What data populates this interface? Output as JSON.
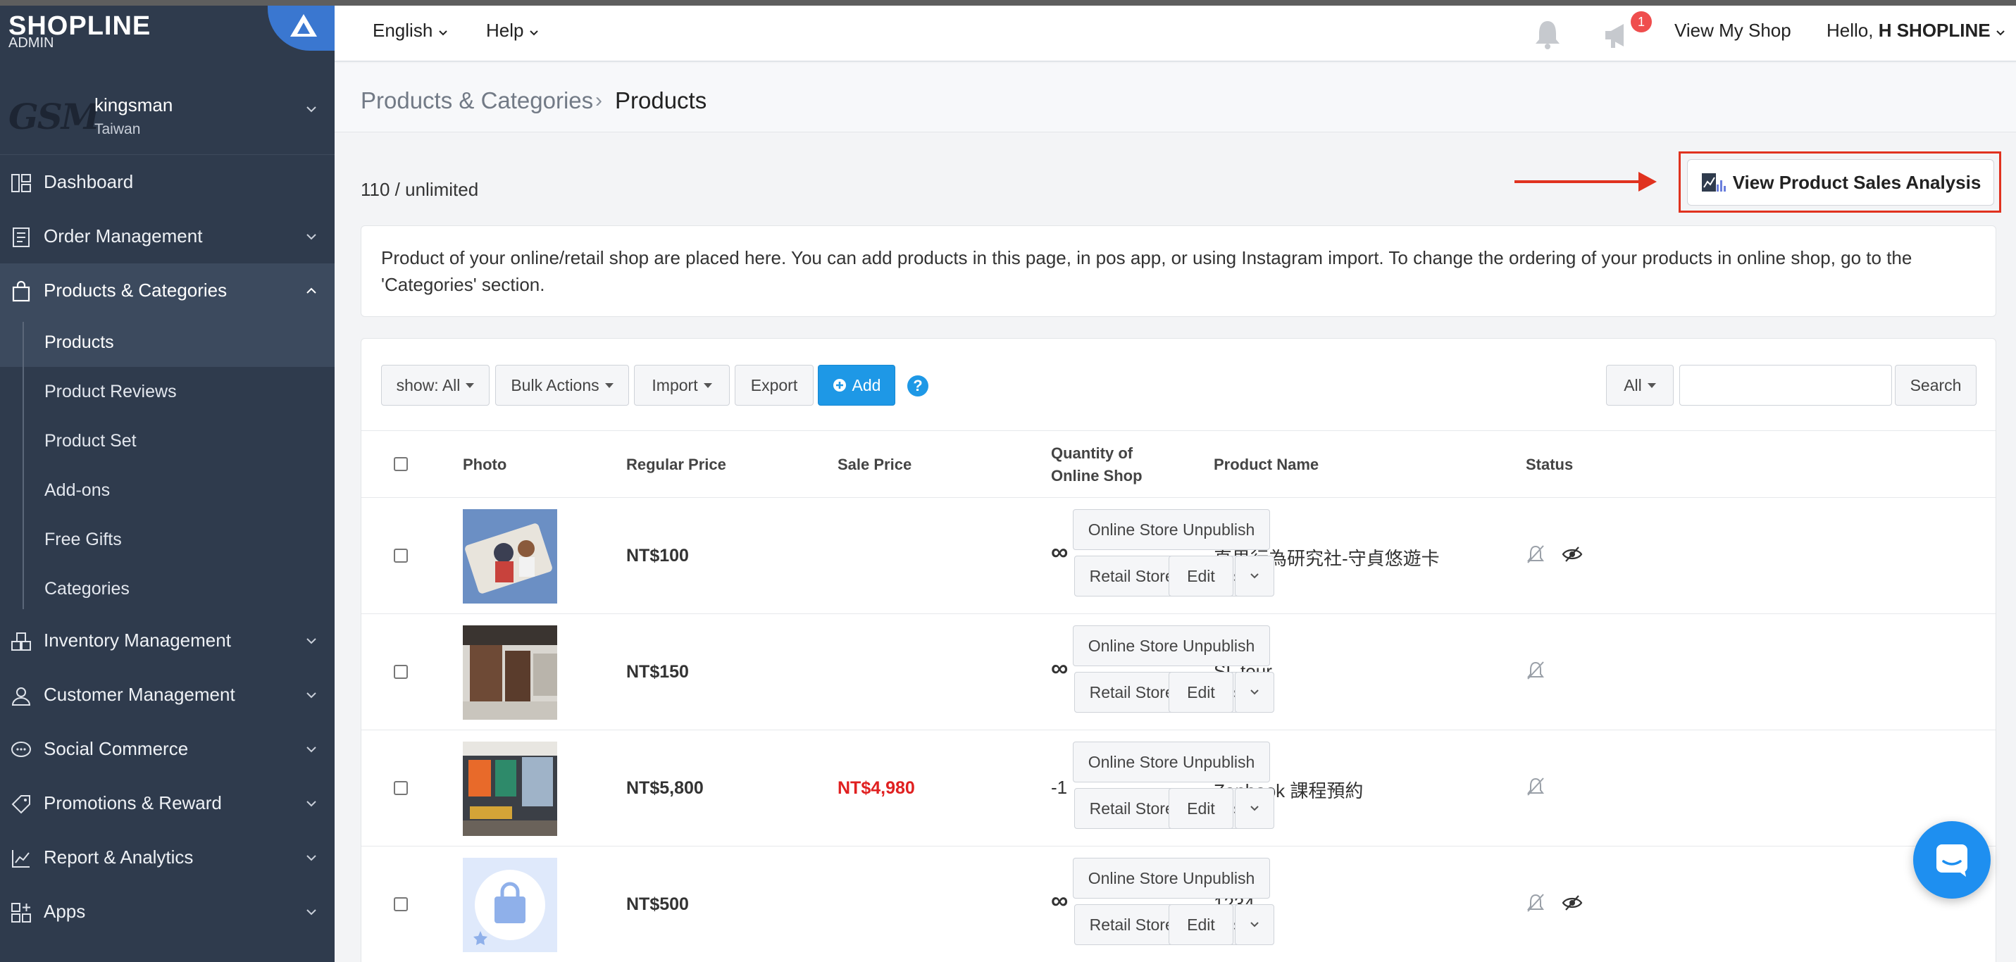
{
  "brand": {
    "logo_text": "SHOPLINE",
    "logo_sub": "ADMIN"
  },
  "shop": {
    "logo_text": "GSM",
    "name": "kingsman",
    "region": "Taiwan"
  },
  "sidebar": {
    "items": [
      {
        "label": "Dashboard",
        "icon": "dashboard-icon"
      },
      {
        "label": "Order Management",
        "icon": "order-icon"
      },
      {
        "label": "Products & Categories",
        "icon": "bag-icon"
      },
      {
        "label": "Inventory Management",
        "icon": "inventory-icon"
      },
      {
        "label": "Customer Management",
        "icon": "user-icon"
      },
      {
        "label": "Social Commerce",
        "icon": "chat-bubble-icon"
      },
      {
        "label": "Promotions & Reward",
        "icon": "tag-icon"
      },
      {
        "label": "Report & Analytics",
        "icon": "analytics-icon"
      },
      {
        "label": "Apps",
        "icon": "apps-icon"
      }
    ],
    "subitems": [
      "Products",
      "Product Reviews",
      "Product Set",
      "Add-ons",
      "Free Gifts",
      "Categories"
    ]
  },
  "topbar": {
    "language": "English",
    "help": "Help",
    "notification_count": "1",
    "view_shop": "View My Shop",
    "greeting": "Hello,",
    "user": "H SHOPLINE"
  },
  "breadcrumb": {
    "parent": "Products & Categories",
    "current": "Products"
  },
  "main": {
    "count": "110 / unlimited",
    "analysis_button": "View Product Sales Analysis",
    "notice": "Product of your online/retail shop are placed here. You can add products in this page, in pos app, or using Instagram import. To change the ordering of your products in online shop, go to the 'Categories' section."
  },
  "toolbar": {
    "show": "show: All",
    "bulk": "Bulk Actions",
    "import": "Import",
    "export": "Export",
    "add": "Add",
    "help": "?",
    "filter": "All",
    "search_placeholder": "",
    "search": "Search"
  },
  "table": {
    "headers": {
      "photo": "Photo",
      "regular": "Regular Price",
      "sale": "Sale Price",
      "qty_1": "Quantity of",
      "qty_2": "Online Shop",
      "name": "Product Name",
      "status": "Status"
    },
    "rows": [
      {
        "regular": "NT$100",
        "sale": "",
        "qty": "∞",
        "name": "直男行為研究社-守貞悠遊卡",
        "hidden_icon": true
      },
      {
        "regular": "NT$150",
        "sale": "",
        "qty": "∞",
        "name": "SL tour",
        "hidden_icon": false
      },
      {
        "regular": "NT$5,800",
        "sale": "NT$4,980",
        "qty": "-1",
        "name": "Zapbook 課程預約",
        "hidden_icon": false
      },
      {
        "regular": "NT$500",
        "sale": "",
        "qty": "∞",
        "name": "1234",
        "hidden_icon": true
      }
    ],
    "actions": {
      "online_unpublish": "Online Store Unpublish",
      "retail_unpublish": "Retail Store Unpublish",
      "edit": "Edit"
    }
  },
  "colors": {
    "sidebar": "#2f3b4d",
    "accent_blue": "#1e98e6",
    "highlight_red": "#e0321f",
    "sale_red": "#e02020"
  }
}
